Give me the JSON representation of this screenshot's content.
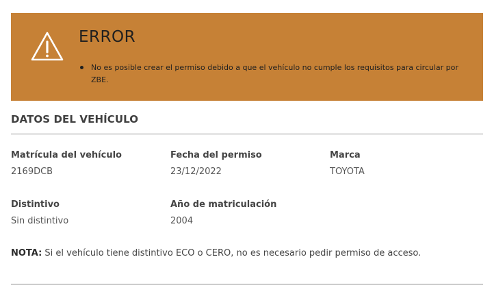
{
  "error": {
    "icon": "warning-triangle-icon",
    "title": "ERROR",
    "messages": [
      "No es posible crear el permiso debido a que el vehículo no cumple los requisitos para circular por ZBE."
    ],
    "background_color": "#c68136"
  },
  "section": {
    "title": "DATOS DEL VEHÍCULO"
  },
  "fields": {
    "matricula": {
      "label": "Matrícula del vehículo",
      "value": "2169DCB"
    },
    "fecha_permiso": {
      "label": "Fecha del permiso",
      "value": "23/12/2022"
    },
    "marca": {
      "label": "Marca",
      "value": "TOYOTA"
    },
    "distintivo": {
      "label": "Distintivo",
      "value": "Sin distintivo"
    },
    "anio_matriculacion": {
      "label": "Año de matriculación",
      "value": "2004"
    }
  },
  "note": {
    "label": "NOTA:",
    "text": " Si el vehículo tiene distintivo ECO o CERO, no es necesario pedir permiso de acceso."
  }
}
